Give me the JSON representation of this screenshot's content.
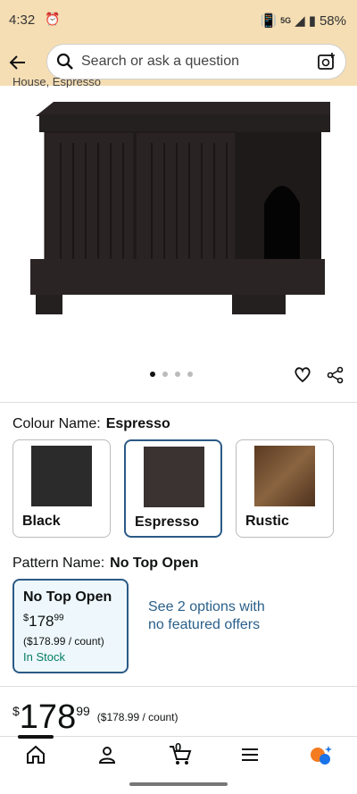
{
  "status": {
    "time": "4:32",
    "network": "5G",
    "battery": "58%"
  },
  "search": {
    "placeholder": "Search or ask a question"
  },
  "product": {
    "title_cut": "House, Espresso"
  },
  "carousel": {
    "dots": 4,
    "active_index": 0
  },
  "colour": {
    "label": "Colour Name:",
    "selected": "Espresso",
    "options": [
      {
        "name": "Black",
        "color": "#2b2b2b"
      },
      {
        "name": "Espresso",
        "color": "#3a3332"
      },
      {
        "name": "Rustic",
        "color": "#6b4a2e"
      }
    ]
  },
  "pattern": {
    "label": "Pattern Name:",
    "selected": "No Top Open",
    "card": {
      "title": "No Top Open",
      "price_currency": "$",
      "price_int": "178",
      "price_frac": "99",
      "unit": "($178.99 / count)",
      "stock": "In Stock"
    },
    "see_options": "See 2 options with no featured offers"
  },
  "price": {
    "currency": "$",
    "int": "178",
    "frac": "99",
    "unit": "($178.99 / count)"
  },
  "nav": {
    "cart_count": "0"
  },
  "colors": {
    "header_bg": "#f5deb3",
    "link": "#2a5f8a",
    "stock": "#067d62",
    "selected_border": "#2a5a86"
  }
}
